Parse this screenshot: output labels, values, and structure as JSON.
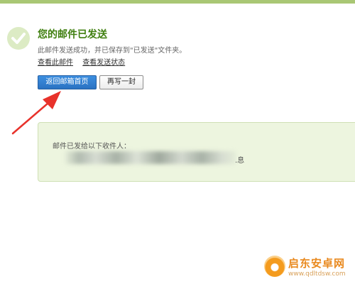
{
  "message": {
    "title": "您的邮件已发送",
    "subtitle": "此邮件发送成功，并已保存到\"已发送\"文件夹。",
    "links": [
      {
        "label": "查看此邮件"
      },
      {
        "label": "查看发送状态"
      }
    ]
  },
  "actions": {
    "back_label": "返回邮箱首页",
    "rewrite_label": "再写一封"
  },
  "recipients": {
    "label": "邮件已发给以下收件人：",
    "redacted_suffix": ".息"
  },
  "watermark": {
    "name": "启东安卓网",
    "url": "www.qdltdsw.com"
  },
  "colors": {
    "top_bar": "#a9c774",
    "title": "#3f7f0f",
    "primary_button": "#2a72c2",
    "panel_background": "#edf5df",
    "annotation_arrow": "#e8322b"
  }
}
